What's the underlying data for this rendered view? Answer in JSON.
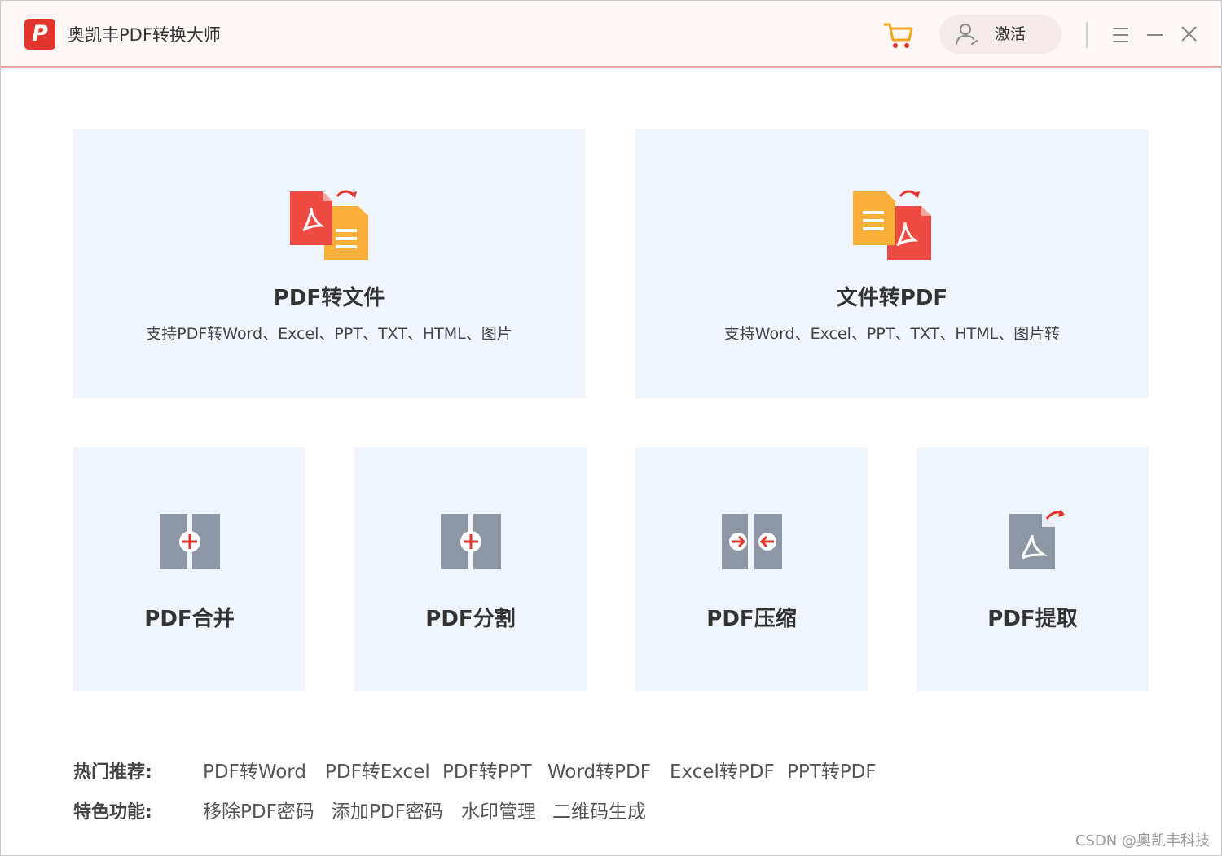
{
  "window": {
    "app_title": "奥凯丰PDF转换大师",
    "logo_letter": "P",
    "activate_label": "激活",
    "icons": [
      "cart-icon",
      "user-icon",
      "menu-icon",
      "minimize-icon",
      "close-icon"
    ]
  },
  "cards": {
    "pdf_to_file": {
      "title": "PDF转文件",
      "desc": "支持PDF转Word、Excel、PPT、TXT、HTML、图片"
    },
    "file_to_pdf": {
      "title": "文件转PDF",
      "desc": "支持Word、Excel、PPT、TXT、HTML、图片转"
    },
    "merge": {
      "title": "PDF合并"
    },
    "split": {
      "title": "PDF分割"
    },
    "compress": {
      "title": "PDF压缩"
    },
    "extract": {
      "title": "PDF提取"
    }
  },
  "hot": {
    "label": "热门推荐:",
    "items": [
      "PDF转Word",
      "PDF转Excel",
      "PDF转PPT",
      "Word转PDF",
      "Excel转PDF",
      "PPT转PDF"
    ]
  },
  "features": {
    "label": "特色功能:",
    "items": [
      "移除PDF密码",
      "添加PDF密码",
      "水印管理",
      "二维码生成"
    ]
  },
  "watermark": "CSDN @奥凯丰科技",
  "colors": {
    "brand_red": "#e2352d",
    "card_bg": "#eff4fd",
    "icon_gray": "#8d97a6",
    "doc_yellow": "#fbb03b"
  }
}
